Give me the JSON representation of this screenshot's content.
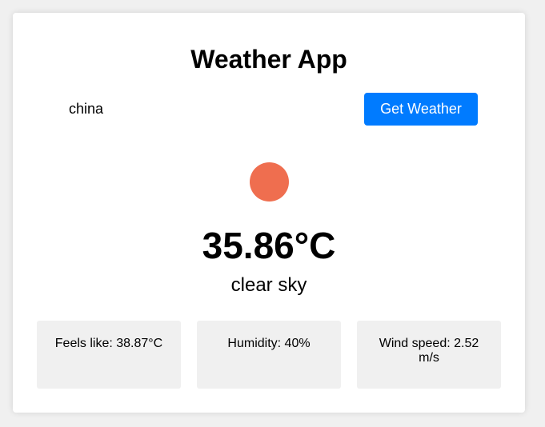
{
  "app": {
    "title": "Weather App"
  },
  "search": {
    "value": "china",
    "button_label": "Get Weather"
  },
  "weather": {
    "icon": "sun-icon",
    "icon_color": "#ef6e4f",
    "temperature": "35.86°C",
    "description": "clear sky"
  },
  "details": [
    {
      "label": "Feels like: 38.87°C"
    },
    {
      "label": "Humidity: 40%"
    },
    {
      "label": "Wind speed: 2.52 m/s"
    }
  ],
  "colors": {
    "accent": "#007bff",
    "card_background": "#ffffff",
    "detail_background": "#f0f0f0"
  }
}
